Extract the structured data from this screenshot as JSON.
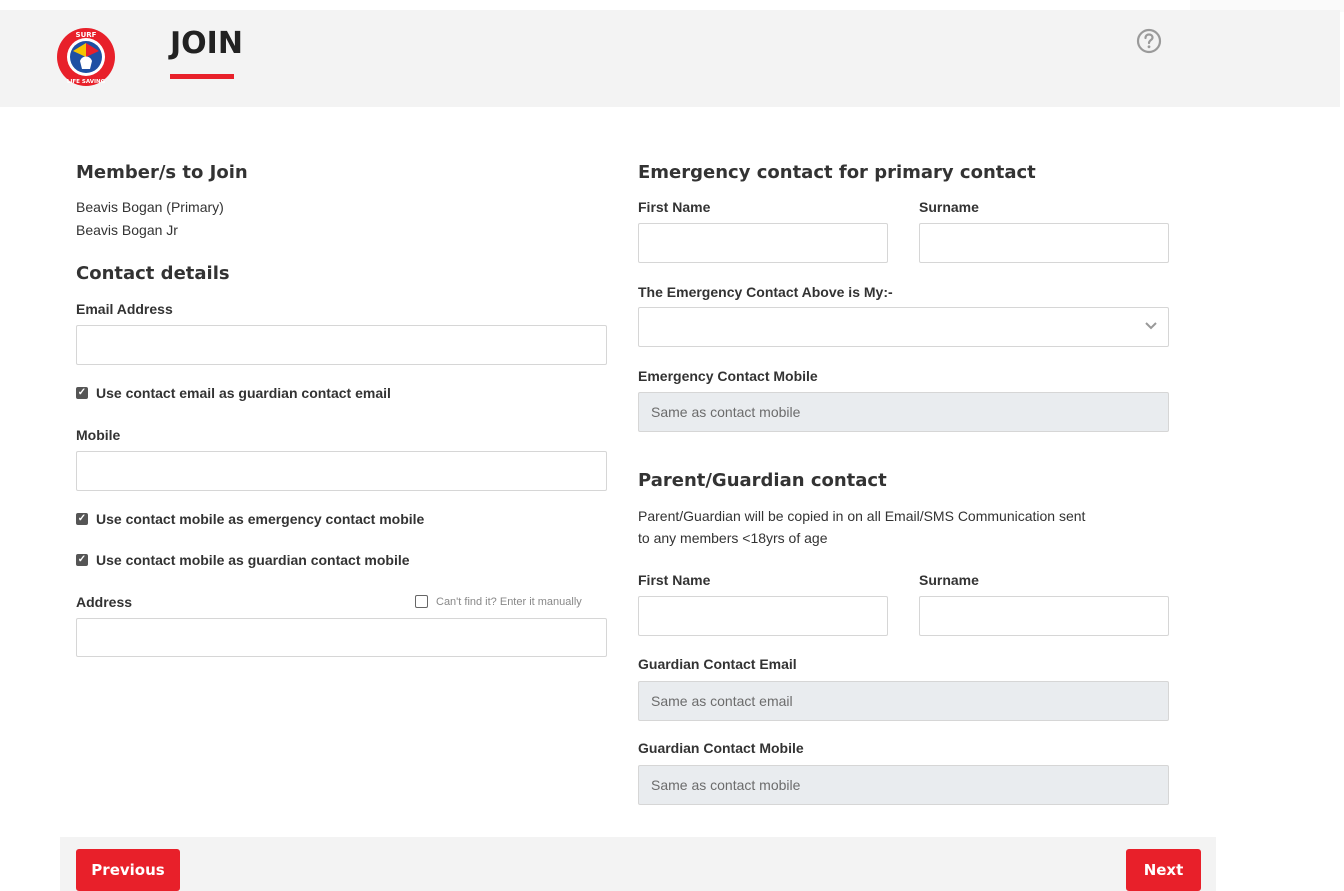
{
  "header": {
    "title": "JOIN",
    "logo_text_top": "SURF",
    "logo_text_bottom": "LIFE SAVING",
    "help_icon": "help-circle-icon",
    "accent_color": "#e8202a"
  },
  "members": {
    "heading": "Member/s to Join",
    "list": [
      "Beavis Bogan (Primary)",
      "Beavis Bogan Jr"
    ]
  },
  "contact": {
    "heading": "Contact details",
    "email_label": "Email Address",
    "email_value": "",
    "guardian_email_check": "Use contact email as guardian contact email",
    "mobile_label": "Mobile",
    "mobile_value": "",
    "emergency_mobile_check": "Use contact mobile as emergency contact mobile",
    "guardian_mobile_check": "Use contact mobile as guardian contact mobile",
    "address_label": "Address",
    "manual_entry_label": "Can't find it? Enter it manually",
    "address_value": ""
  },
  "emergency": {
    "heading": "Emergency contact for primary contact",
    "first_name_label": "First Name",
    "surname_label": "Surname",
    "relationship_label": "The Emergency Contact Above is My:-",
    "relationship_value": "",
    "mobile_label": "Emergency Contact Mobile",
    "mobile_value": "Same as contact mobile"
  },
  "guardian": {
    "heading": "Parent/Guardian contact",
    "description_line1": "Parent/Guardian will be copied in on all Email/SMS Communication sent",
    "description_line2": "to any members <18yrs of age",
    "first_name_label": "First Name",
    "surname_label": "Surname",
    "email_label": "Guardian Contact Email",
    "email_value": "Same as contact email",
    "mobile_label": "Guardian Contact Mobile",
    "mobile_value": "Same as contact mobile"
  },
  "footer": {
    "previous_label": "Previous",
    "next_label": "Next"
  }
}
